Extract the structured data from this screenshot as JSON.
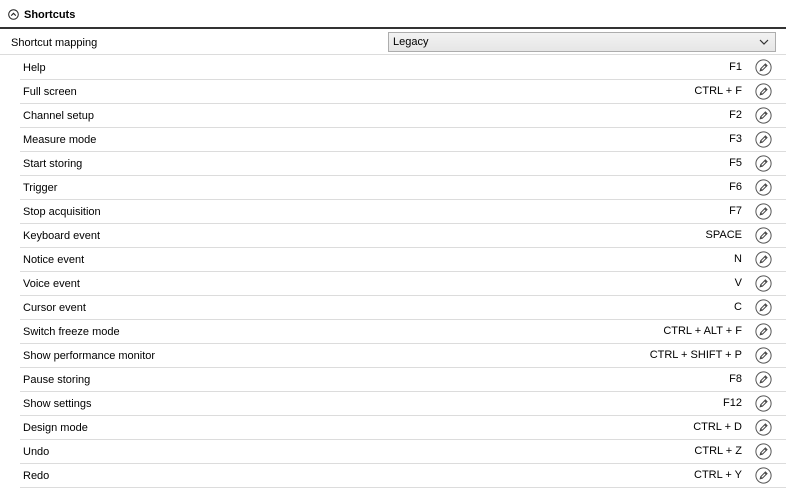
{
  "section": {
    "title": "Shortcuts",
    "collapse_icon": "circle-chevron-up-icon"
  },
  "mapping": {
    "label": "Shortcut mapping",
    "selected": "Legacy",
    "dropdown_icon": "chevron-down-icon"
  },
  "shortcuts": [
    {
      "label": "Help",
      "keys": "F1"
    },
    {
      "label": "Full screen",
      "keys": "CTRL + F"
    },
    {
      "label": "Channel setup",
      "keys": "F2"
    },
    {
      "label": "Measure mode",
      "keys": "F3"
    },
    {
      "label": "Start storing",
      "keys": "F5"
    },
    {
      "label": "Trigger",
      "keys": "F6"
    },
    {
      "label": "Stop acquisition",
      "keys": "F7"
    },
    {
      "label": "Keyboard event",
      "keys": "SPACE"
    },
    {
      "label": "Notice event",
      "keys": "N"
    },
    {
      "label": "Voice event",
      "keys": "V"
    },
    {
      "label": "Cursor event",
      "keys": "C"
    },
    {
      "label": "Switch freeze mode",
      "keys": "CTRL + ALT + F"
    },
    {
      "label": "Show performance monitor",
      "keys": "CTRL + SHIFT + P"
    },
    {
      "label": "Pause storing",
      "keys": "F8"
    },
    {
      "label": "Show settings",
      "keys": "F12"
    },
    {
      "label": "Design mode",
      "keys": "CTRL + D"
    },
    {
      "label": "Undo",
      "keys": "CTRL + Z"
    },
    {
      "label": "Redo",
      "keys": "CTRL + Y"
    }
  ],
  "row_edit_icon": "pencil-circle-icon"
}
